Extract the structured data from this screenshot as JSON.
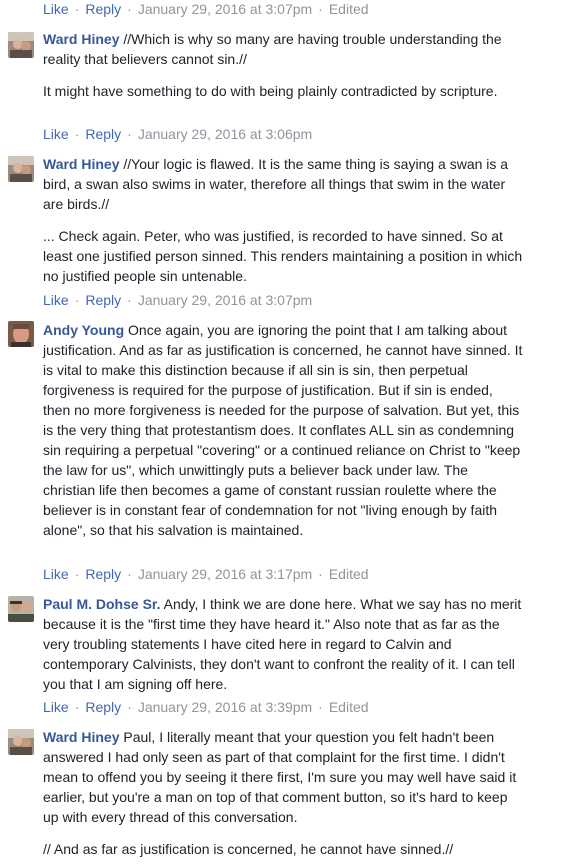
{
  "labels": {
    "like": "Like",
    "reply": "Reply",
    "sep": "·",
    "edited": "Edited"
  },
  "top_actions": {
    "timestamp": "January 29, 2016 at 3:07pm"
  },
  "comments": [
    {
      "author": "Ward Hiney",
      "text": " //Which is why so many are having trouble understanding the reality that believers cannot sin.//",
      "paragraphs": [
        "It might have something to do with being plainly contradicted by scripture."
      ],
      "timestamp": "January 29, 2016 at 3:06pm"
    },
    {
      "author": "Ward Hiney",
      "text": " //Your logic is flawed. It is the same thing is saying a swan is a bird, a swan also swims in water, therefore all things that swim in the water are birds.//",
      "paragraphs": [
        "... Check again. Peter, who was justified, is recorded to have sinned. So at least one justified person sinned. This renders maintaining a position in which no justified people sin untenable."
      ],
      "timestamp": "January 29, 2016 at 3:07pm"
    },
    {
      "author": "Andy Young",
      "text": " Once again, you are ignoring the point that I am talking about justification. And as far as justification is concerned, he cannot have sinned. It is vital to make this distinction because if all sin is sin, then perpetual forgiveness is required for the purpose of justification. But if sin is ended, then no more forgiveness is needed for the purpose of salvation. But yet, this is the very thing that protestantism does. It conflates ALL sin as condemning sin requiring a perpetual \"covering\" or a continued reliance on Christ to \"keep the law for us\", which unwittingly puts a believer back under law. The christian life then becomes a game of constant russian roulette where the believer is in constant fear of condemnation for not \"living enough by faith alone\", so that his salvation is maintained.",
      "paragraphs": [],
      "timestamp": "January 29, 2016 at 3:17pm"
    },
    {
      "author": "Paul M. Dohse Sr.",
      "text": " Andy, I think we are done here. What we say has no merit because it is the \"first time they have heard it.\" Also note that as far as the very troubling statements I have cited here in regard to Calvin and contemporary Calvinists, they don't want to confront the reality of it. I can tell you that I am signing off here.",
      "paragraphs": [],
      "timestamp": "January 29, 2016 at 3:39pm"
    },
    {
      "author": "Ward Hiney",
      "text": " Paul, I literally meant that your question you felt hadn't been answered I had only seen as part of that complaint for the first time. I didn't mean to offend you by seeing it there first, I'm sure you may well have said it earlier, but you're a man on top of that comment button, so it's hard to keep up with every thread of this conversation.",
      "paragraphs": [
        "// And as far as justification is concerned, he cannot have sinned.//"
      ]
    }
  ]
}
